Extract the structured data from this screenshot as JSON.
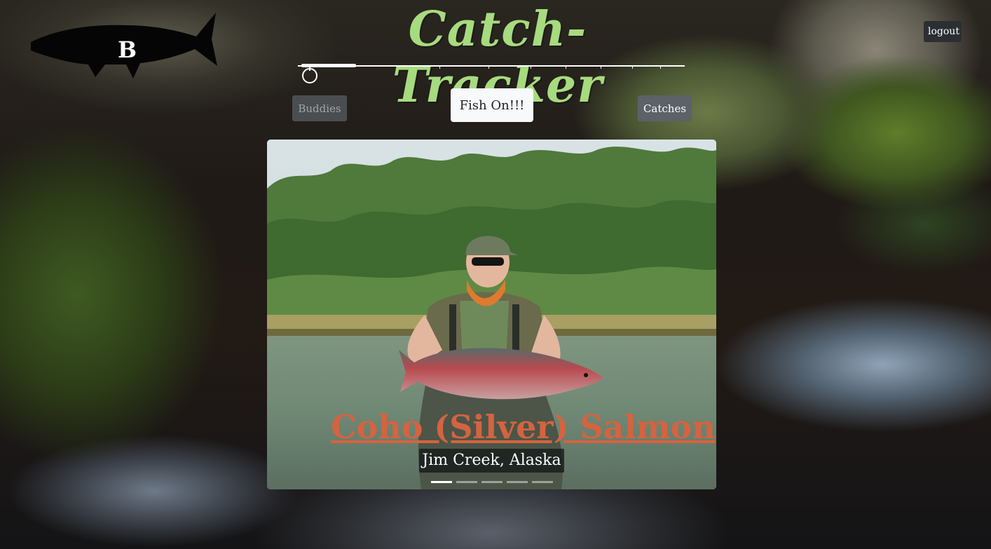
{
  "header": {
    "logo_letter": "B",
    "title": "Catch-Tracker",
    "logout_label": "logout"
  },
  "nav": {
    "buddies_label": "Buddies",
    "fish_on_label": "Fish On!!!",
    "catches_label": "Catches"
  },
  "carousel": {
    "slide_count": 5,
    "active_index": 0,
    "current": {
      "species": "Coho (Silver) Salmon",
      "location": "Jim Creek, Alaska"
    },
    "prev_icon": "chevron-left-icon",
    "next_icon": "chevron-right-icon"
  },
  "colors": {
    "title_green": "#a7db7f",
    "species_orange": "#d5633f",
    "button_gray": "#5b6268"
  }
}
